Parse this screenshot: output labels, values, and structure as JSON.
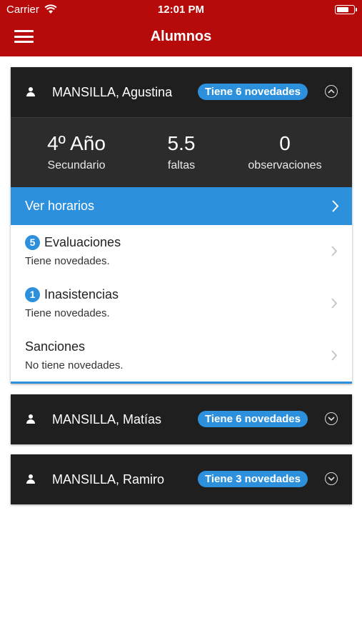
{
  "status_bar": {
    "carrier": "Carrier",
    "time": "12:01 PM"
  },
  "nav": {
    "title": "Alumnos",
    "menu_icon": "hamburger-icon"
  },
  "colors": {
    "header": "#b70a0a",
    "accent": "#2d90dc",
    "card_dark": "#1f1f1f"
  },
  "students": [
    {
      "name": "MANSILLA, Agustina",
      "badge": "Tiene 6 novedades",
      "expanded": true,
      "stats": [
        {
          "value": "4º Año",
          "label": "Secundario"
        },
        {
          "value": "5.5",
          "label": "faltas"
        },
        {
          "value": "0",
          "label": "observaciones"
        }
      ],
      "horarios_label": "Ver horarios",
      "sections": [
        {
          "count": "5",
          "title": "Evaluaciones",
          "subtitle": "Tiene novedades."
        },
        {
          "count": "1",
          "title": "Inasistencias",
          "subtitle": "Tiene novedades."
        },
        {
          "count": "",
          "title": "Sanciones",
          "subtitle": "No tiene novedades."
        }
      ]
    },
    {
      "name": "MANSILLA, Matías",
      "badge": "Tiene 6 novedades",
      "expanded": false
    },
    {
      "name": "MANSILLA, Ramiro",
      "badge": "Tiene 3 novedades",
      "expanded": false
    }
  ]
}
